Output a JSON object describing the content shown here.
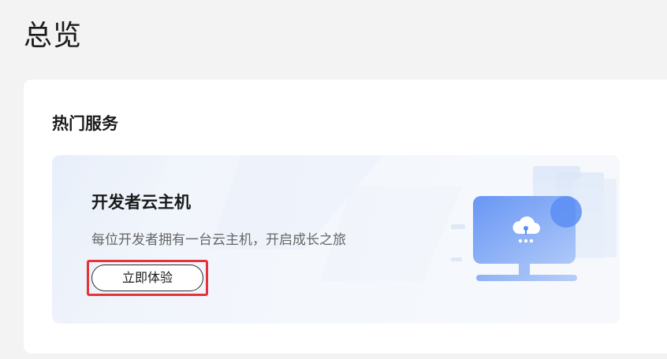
{
  "page": {
    "title": "总览"
  },
  "hot_services": {
    "title": "热门服务",
    "card": {
      "title": "开发者云主机",
      "description": "每位开发者拥有一台云主机，开启成长之旅",
      "button_label": "立即体验",
      "illustration_icon": "cloud-monitor-icon",
      "highlight_color": "#e5333b"
    }
  },
  "colors": {
    "background": "#f3f3f3",
    "panel": "#ffffff",
    "accent_blue": "#6f9ef5",
    "highlight": "#e5333b"
  }
}
